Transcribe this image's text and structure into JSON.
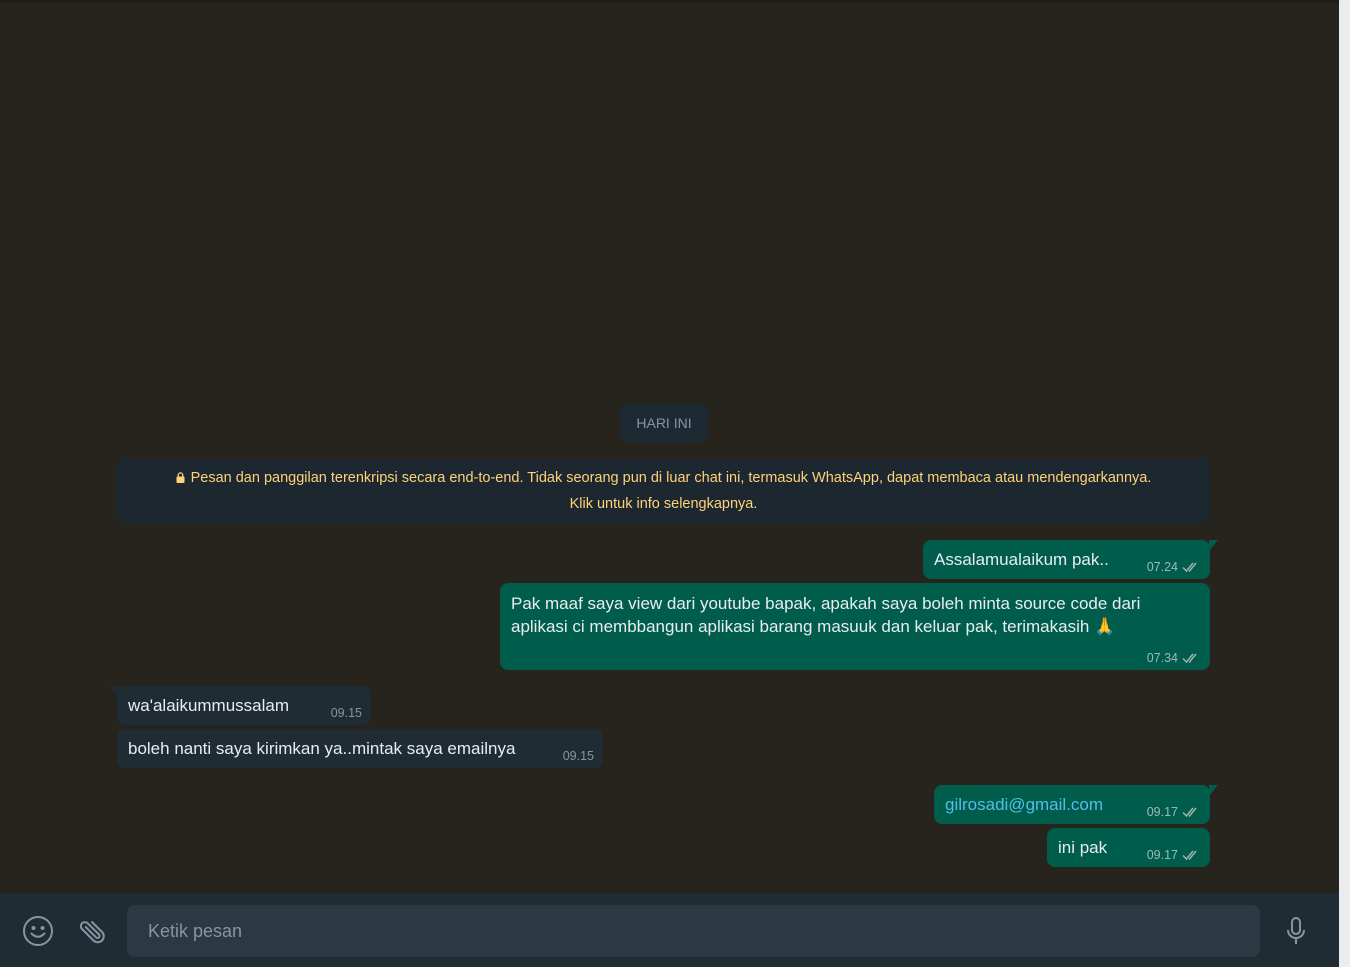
{
  "date_chip": "HARI INI",
  "encryption_notice": {
    "line1": "Pesan dan panggilan terenkripsi secara end-to-end. Tidak seorang pun di luar chat ini, termasuk WhatsApp, dapat membaca atau mendengarkannya.",
    "line2": "Klik untuk info selengkapnya.",
    "icon": "lock-icon"
  },
  "messages": [
    {
      "direction": "out",
      "text": "Assalamualaikum pak..",
      "time": "07.24",
      "status": "read"
    },
    {
      "direction": "out",
      "line1": "Pak maaf saya view dari youtube bapak, apakah saya boleh minta source code dari",
      "line2": "aplikasi ci membbangun aplikasi barang masuuk dan keluar pak, terimakasih 🙏",
      "time": "07.34",
      "status": "read"
    },
    {
      "direction": "in",
      "text": "wa'alaikummussalam",
      "time": "09.15"
    },
    {
      "direction": "in",
      "text": "boleh nanti saya kirimkan ya..mintak saya emailnya",
      "time": "09.15"
    },
    {
      "direction": "out",
      "text": "gilrosadi@gmail.com",
      "time": "09.17",
      "status": "read",
      "is_link": true
    },
    {
      "direction": "out",
      "text": "ini pak",
      "time": "09.17",
      "status": "read"
    }
  ],
  "composer": {
    "placeholder": "Ketik pesan",
    "emoji_icon": "smiley-icon",
    "attach_icon": "paperclip-icon",
    "mic_icon": "microphone-icon"
  },
  "colors": {
    "chat_background": "#26241d",
    "outgoing_bubble": "#005c4b",
    "incoming_bubble": "#1f2c33",
    "notice_text": "#ffd279",
    "link": "#53bdeb",
    "composer_bg": "#202c33"
  }
}
